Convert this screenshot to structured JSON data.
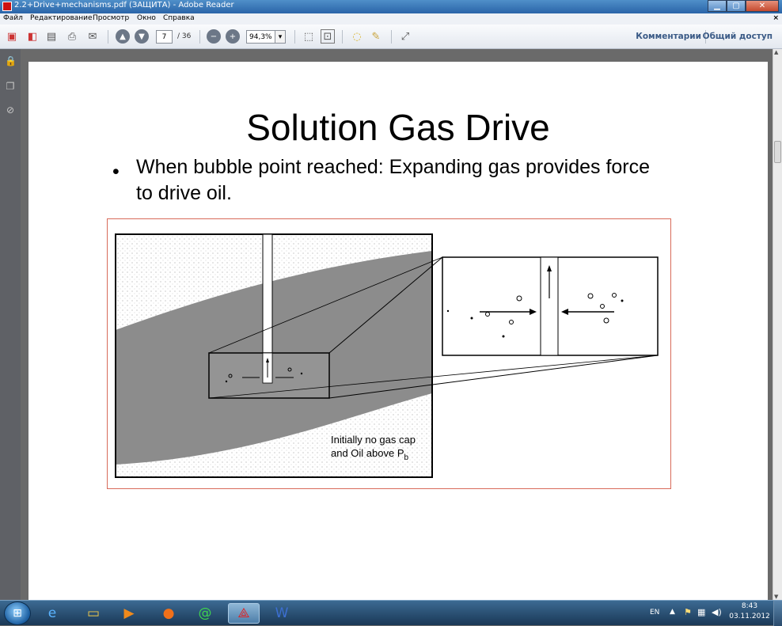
{
  "window": {
    "title": "2.2+Drive+mechanisms.pdf (ЗАЩИТА) - Adobe Reader",
    "close_glyph": "✕",
    "minimize_glyph": "▁",
    "maximize_glyph": "▢"
  },
  "menu": {
    "items": [
      "Файл",
      "Редактирование",
      "Просмотр",
      "Окно",
      "Справка"
    ],
    "close_glyph": "×"
  },
  "toolbar": {
    "page_current": "7",
    "page_total": "/ 36",
    "zoom": "94,3%",
    "zoom_dropdown_glyph": "▾",
    "comments_label": "Комментарии",
    "share_label": "Общий доступ"
  },
  "document": {
    "title": "Solution Gas Drive",
    "bullet_glyph": "•",
    "bullet_text": "When bubble point reached: Expanding gas provides force to drive oil.",
    "figure_caption_line1": "Initially no gas cap",
    "figure_caption_line2_prefix": "and Oil above P",
    "figure_caption_subscript": "b"
  },
  "taskbar": {
    "apps": [
      "internet-explorer-icon",
      "file-explorer-icon",
      "media-player-icon",
      "firefox-icon",
      "mail-agent-icon",
      "adobe-reader-icon",
      "word-icon"
    ],
    "tray_lang": "EN",
    "time": "8:43",
    "date": "03.11.2012"
  },
  "colors": {
    "title_bar": "#2a64a8",
    "link_blue": "#3a5a86",
    "figure_border": "#d86b5a",
    "rock_gray": "#8c8c8c"
  }
}
